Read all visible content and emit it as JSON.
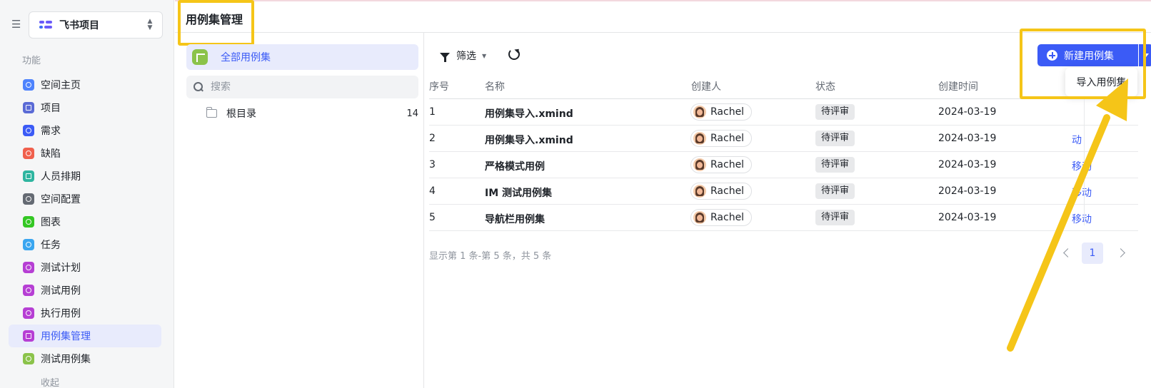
{
  "sidebar": {
    "project_name": "飞书项目",
    "section_label": "功能",
    "items": [
      {
        "label": "空间主页",
        "icon": "info-icon",
        "color": "#4e83fd"
      },
      {
        "label": "项目",
        "icon": "folder-icon",
        "color": "#5b6bd6"
      },
      {
        "label": "需求",
        "icon": "check-circle-icon",
        "color": "#3b5bf6"
      },
      {
        "label": "缺陷",
        "icon": "alert-icon",
        "color": "#f0604d"
      },
      {
        "label": "人员排期",
        "icon": "calendar-icon",
        "color": "#2fb5a0"
      },
      {
        "label": "空间配置",
        "icon": "settings-icon",
        "color": "#646a73"
      },
      {
        "label": "图表",
        "icon": "chart-icon",
        "color": "#34c724"
      },
      {
        "label": "任务",
        "icon": "task-icon",
        "color": "#3aa6f0"
      },
      {
        "label": "测试计划",
        "icon": "bookmark-icon",
        "color": "#b63fd4"
      },
      {
        "label": "测试用例",
        "icon": "bookmark-icon",
        "color": "#b63fd4"
      },
      {
        "label": "执行用例",
        "icon": "bookmark-icon",
        "color": "#b63fd4"
      },
      {
        "label": "用例集管理",
        "icon": "folder-icon",
        "color": "#b63fd4"
      },
      {
        "label": "测试用例集",
        "icon": "list-icon",
        "color": "#8bc34a"
      }
    ],
    "active_index": 11,
    "collapse_label": "收起"
  },
  "header": {
    "title": "用例集管理"
  },
  "tree": {
    "all_label": "全部用例集",
    "search_placeholder": "搜索",
    "root_label": "根目录",
    "root_count": "14"
  },
  "toolbar": {
    "filter_label": "筛选",
    "new_button_label": "新建用例集",
    "dropdown_item": "导入用例集"
  },
  "table": {
    "columns": [
      "序号",
      "名称",
      "创建人",
      "状态",
      "创建时间"
    ],
    "rows": [
      {
        "index": "1",
        "name": "用例集导入.xmind",
        "creator": "Rachel",
        "status": "待评审",
        "created": "2024-03-19",
        "action": ""
      },
      {
        "index": "2",
        "name": "用例集导入.xmind",
        "creator": "Rachel",
        "status": "待评审",
        "created": "2024-03-19",
        "action": "动"
      },
      {
        "index": "3",
        "name": "严格模式用例",
        "creator": "Rachel",
        "status": "待评审",
        "created": "2024-03-19",
        "action": "移动"
      },
      {
        "index": "4",
        "name": "IM 测试用例集",
        "creator": "Rachel",
        "status": "待评审",
        "created": "2024-03-19",
        "action": "移动"
      },
      {
        "index": "5",
        "name": "导航栏用例集",
        "creator": "Rachel",
        "status": "待评审",
        "created": "2024-03-19",
        "action": "移动"
      }
    ]
  },
  "pagination": {
    "summary": "显示第 1 条-第 5 条，共 5 条",
    "current_page": "1"
  },
  "colors": {
    "accent": "#3b5bf6",
    "highlight": "#f5c518"
  }
}
